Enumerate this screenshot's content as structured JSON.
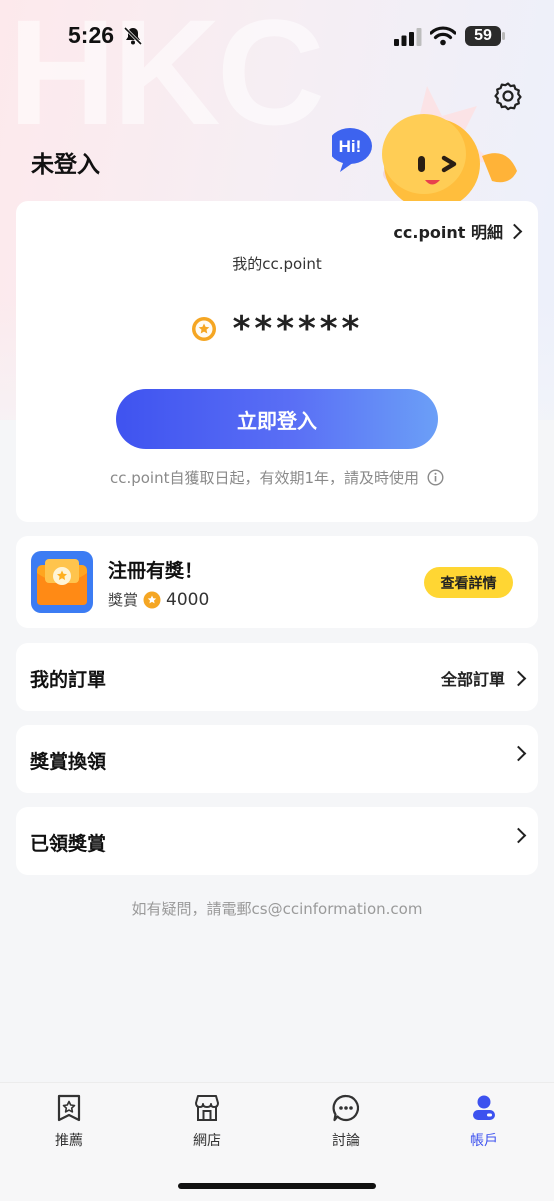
{
  "status_bar": {
    "time": "5:26",
    "battery": "59"
  },
  "header": {
    "watermark": "HKC",
    "title": "未登入",
    "mascot_bubble": "Hi!"
  },
  "points_card": {
    "detail_link": "cc.point 明細",
    "label": "我的cc.point",
    "masked_value": "******",
    "login_button": "立即登入",
    "note": "cc.point自獲取日起，有效期1年，請及時使用"
  },
  "reward_card": {
    "title": "注冊有獎！",
    "sub_label": "獎賞",
    "amount": "4000",
    "button": "查看詳情"
  },
  "rows": [
    {
      "title": "我的訂單",
      "right": "全部訂單"
    },
    {
      "title": "獎賞換領",
      "right": ""
    },
    {
      "title": "已領獎賞",
      "right": ""
    }
  ],
  "footer_note": "如有疑問，請電郵cs@ccinformation.com",
  "tabs": [
    {
      "label": "推薦",
      "icon": "star-bookmark-icon"
    },
    {
      "label": "網店",
      "icon": "store-icon"
    },
    {
      "label": "討論",
      "icon": "chat-bubble-icon"
    },
    {
      "label": "帳戶",
      "icon": "account-icon",
      "active": true
    }
  ],
  "colors": {
    "accent": "#3d52ef",
    "badge_yellow": "#ffd633",
    "coin": "#f5a623"
  }
}
